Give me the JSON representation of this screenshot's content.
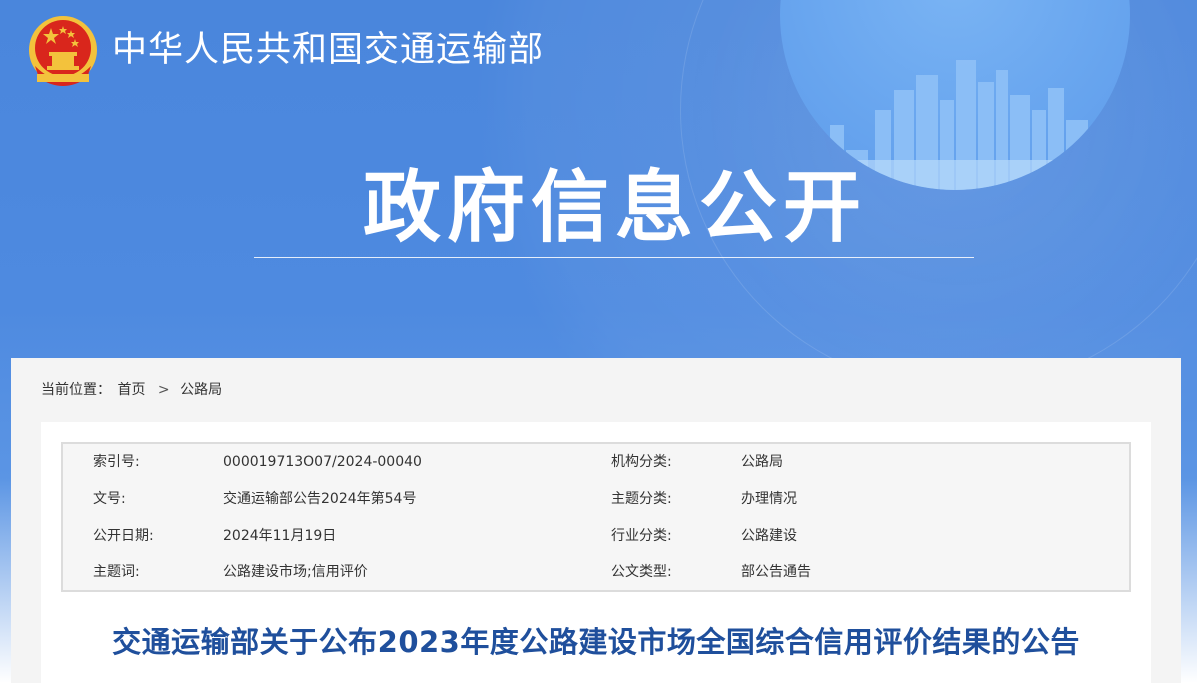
{
  "header": {
    "site_title": "中华人民共和国交通运输部",
    "banner_title": "政府信息公开"
  },
  "breadcrumb": {
    "label": "当前位置：",
    "items": [
      "首页",
      "公路局"
    ],
    "separator": ">"
  },
  "metadata": [
    {
      "label1": "索引号:",
      "value1": "000019713O07/2024-00040",
      "label2": "机构分类:",
      "value2": "公路局"
    },
    {
      "label1": "文号:",
      "value1": "交通运输部公告2024年第54号",
      "label2": "主题分类:",
      "value2": "办理情况"
    },
    {
      "label1": "公开日期:",
      "value1": "2024年11月19日",
      "label2": "行业分类:",
      "value2": "公路建设"
    },
    {
      "label1": "主题词:",
      "value1": "公路建设市场;信用评价",
      "label2": "公文类型:",
      "value2": "部公告通告"
    }
  ],
  "document": {
    "title": "交通运输部关于公布2023年度公路建设市场全国综合信用评价结果的公告"
  },
  "colors": {
    "banner_blue": "#4a86dc",
    "title_blue": "#1f4f9c",
    "emblem_red": "#d9261c",
    "emblem_gold": "#f3c23c"
  },
  "icons": {
    "emblem": "national-emblem-icon"
  }
}
